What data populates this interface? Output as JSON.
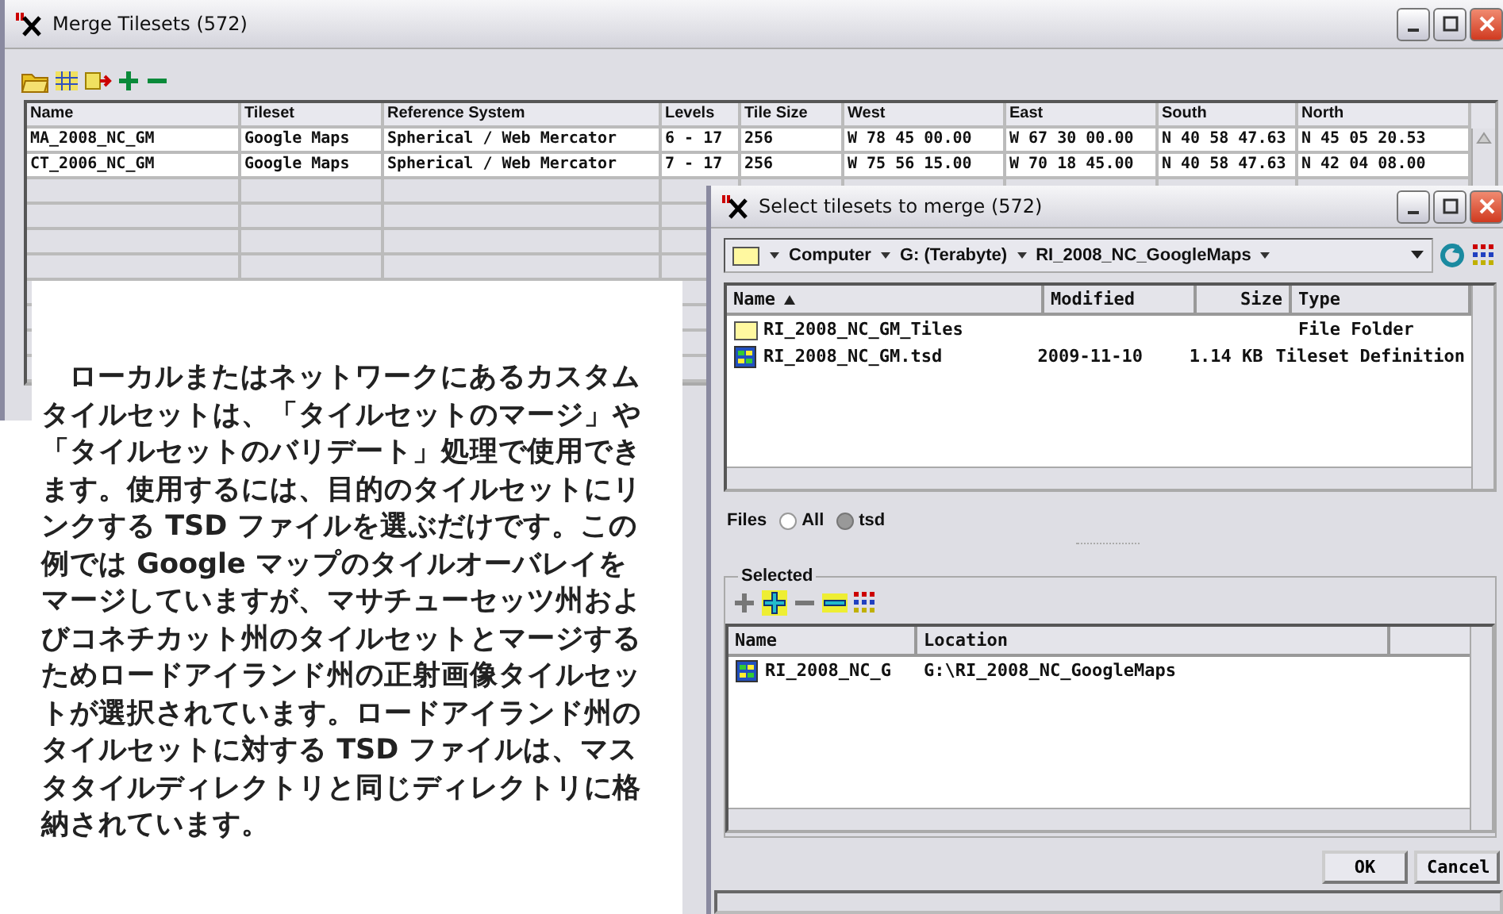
{
  "main_window": {
    "title": "Merge Tilesets (572)",
    "table": {
      "columns": [
        "Name",
        "Tileset",
        "Reference System",
        "Levels",
        "Tile Size",
        "West",
        "East",
        "South",
        "North"
      ],
      "rows": [
        [
          "MA_2008_NC_GM",
          "Google Maps",
          "Spherical / Web Mercator",
          "6 - 17",
          "256",
          "W 78 45 00.00",
          "W 67 30 00.00",
          "N 40 58 47.63",
          "N 45 05 20.53"
        ],
        [
          "CT_2006_NC_GM",
          "Google Maps",
          "Spherical / Web Mercator",
          "7 - 17",
          "256",
          "W 75 56 15.00",
          "W 70 18 45.00",
          "N 40 58 47.63",
          "N 42 04 08.00"
        ]
      ]
    }
  },
  "dialog": {
    "title": "Select tilesets to merge (572)",
    "path": [
      "Computer",
      "G: (Terabyte)",
      "RI_2008_NC_GoogleMaps"
    ],
    "file_list": {
      "columns": [
        {
          "label": "Name",
          "sorted": true
        },
        {
          "label": "Modified",
          "sorted": false
        },
        {
          "label": "Size",
          "sorted": false
        },
        {
          "label": "Type",
          "sorted": false
        }
      ],
      "rows": [
        {
          "kind": "folder",
          "name": "RI_2008_NC_GM_Tiles",
          "modified": "",
          "size": "",
          "type": "File Folder"
        },
        {
          "kind": "tsd",
          "name": "RI_2008_NC_GM.tsd",
          "modified": "2009-11-10",
          "size": "1.14 KB",
          "type": "Tileset Definition"
        }
      ]
    },
    "filter": {
      "label": "Files",
      "options": [
        {
          "label": "All",
          "selected": false
        },
        {
          "label": "tsd",
          "selected": true
        }
      ]
    },
    "selected": {
      "title": "Selected",
      "columns": [
        "Name",
        "Location"
      ],
      "rows": [
        {
          "name": "RI_2008_NC_G",
          "location": "G:\\RI_2008_NC_GoogleMaps"
        }
      ]
    },
    "buttons": [
      "OK",
      "Cancel"
    ]
  },
  "annotation": {
    "text": "ローカルまたはネットワークにあるカスタムタイルセットは、「タイルセットのマージ」や「タイルセットのバリデート」処理で使用できます。使用するには、目的のタイルセットにリンクする TSD ファイルを選ぶだけです。この例では Google マップのタイルオーバレイをマージしていますが、マサチューセッツ州およびコネチカット州のタイルセットとマージするためロードアイランド州の正射画像タイルセットが選択されています。ロードアイランド州のタイルセットに対する TSD ファイルは、マスタタイルディレクトリと同じディレクトリに格納されています。"
  }
}
